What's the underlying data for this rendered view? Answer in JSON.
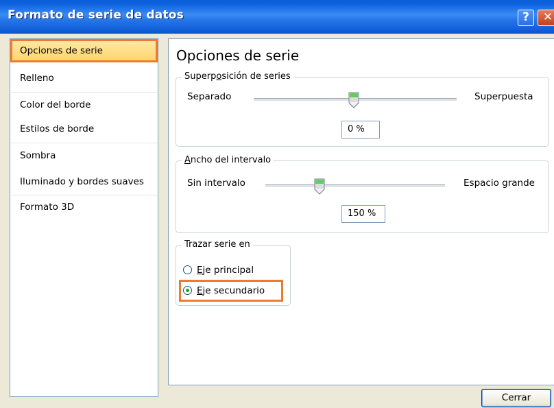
{
  "window": {
    "title": "Formato de serie de datos",
    "help_label": "?",
    "close_label": "✕"
  },
  "nav": {
    "items": [
      {
        "label": "Opciones de serie",
        "selected": true
      },
      {
        "label": "Relleno"
      },
      {
        "label": "Color del borde"
      },
      {
        "label": "Estilos de borde"
      },
      {
        "label": "Sombra"
      },
      {
        "label": "Iluminado y bordes suaves"
      },
      {
        "label": "Formato 3D"
      }
    ]
  },
  "panel": {
    "title": "Opciones de serie",
    "overlap": {
      "legend_pre": "Superp",
      "legend_ul": "o",
      "legend_post": "sición de series",
      "min_label": "Separado",
      "max_label": "Superpuesta",
      "value": "0 %",
      "position_fraction": 0.5
    },
    "gap": {
      "legend_pre": "",
      "legend_ul": "A",
      "legend_post": "ncho del intervalo",
      "min_label": "Sin intervalo",
      "max_label": "Espacio grande",
      "value": "150 %",
      "position_fraction": 0.3
    },
    "plot_on": {
      "legend": "Trazar serie en",
      "options": [
        {
          "ul": "E",
          "rest": "je principal",
          "checked": false
        },
        {
          "ul": "E",
          "rest": "je secundario",
          "checked": true
        }
      ]
    }
  },
  "footer": {
    "close_button": "Cerrar"
  },
  "colors": {
    "highlight": "#ef7a2d",
    "titlebar": "#2677ea",
    "selected_bg": "#ffd46b"
  }
}
